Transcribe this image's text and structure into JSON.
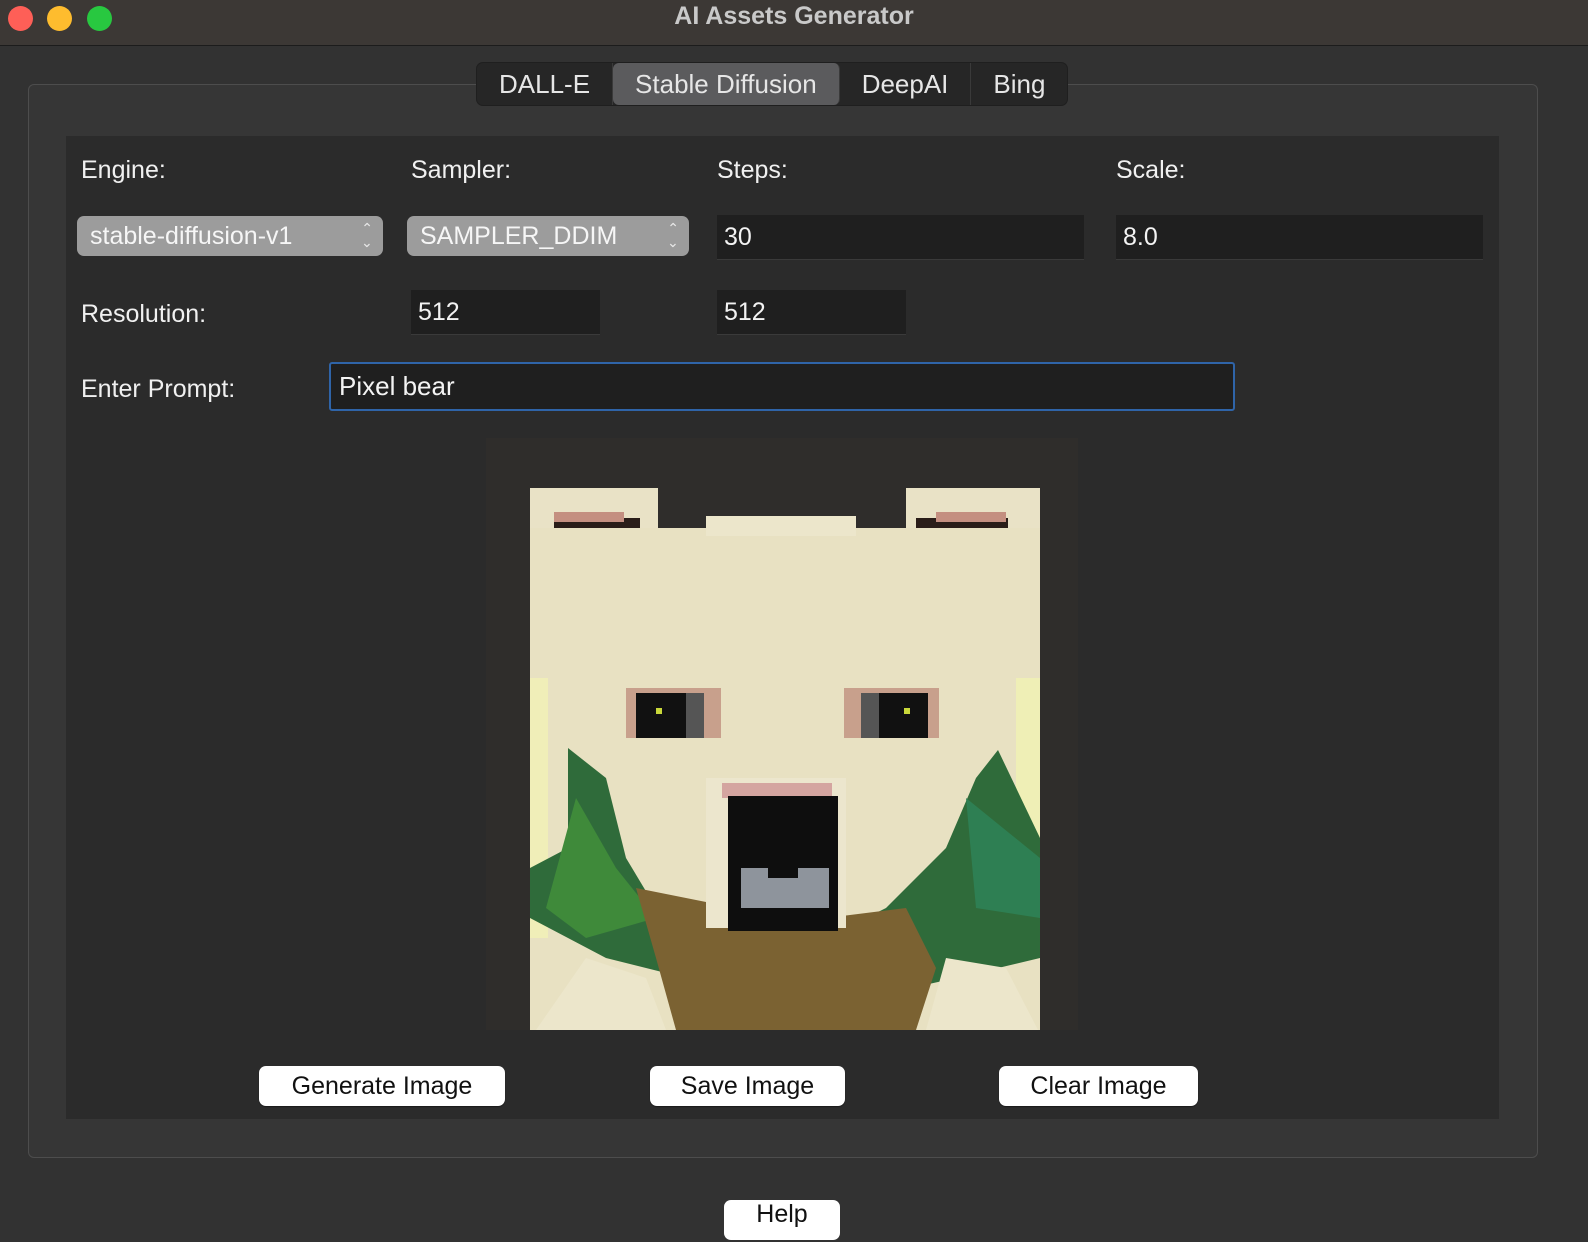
{
  "window": {
    "title": "AI Assets Generator"
  },
  "tabs": [
    {
      "label": "DALL-E",
      "active": false
    },
    {
      "label": "Stable Diffusion",
      "active": true
    },
    {
      "label": "DeepAI",
      "active": false
    },
    {
      "label": "Bing",
      "active": false
    }
  ],
  "form": {
    "engine_label": "Engine:",
    "engine_value": "stable-diffusion-v1",
    "sampler_label": "Sampler:",
    "sampler_value": "SAMPLER_DDIM",
    "steps_label": "Steps:",
    "steps_value": "30",
    "scale_label": "Scale:",
    "scale_value": "8.0",
    "resolution_label": "Resolution:",
    "resolution_width": "512",
    "resolution_height": "512",
    "prompt_label": "Enter Prompt:",
    "prompt_value": "Pixel bear"
  },
  "image": {
    "icon": "pixel-bear-image"
  },
  "buttons": {
    "generate": "Generate Image",
    "save": "Save Image",
    "clear": "Clear Image",
    "help": "Help"
  },
  "colors": {
    "accent": "#2f64a8",
    "close": "#fe5f57",
    "minimize": "#febc2e",
    "maximize": "#28c840"
  }
}
